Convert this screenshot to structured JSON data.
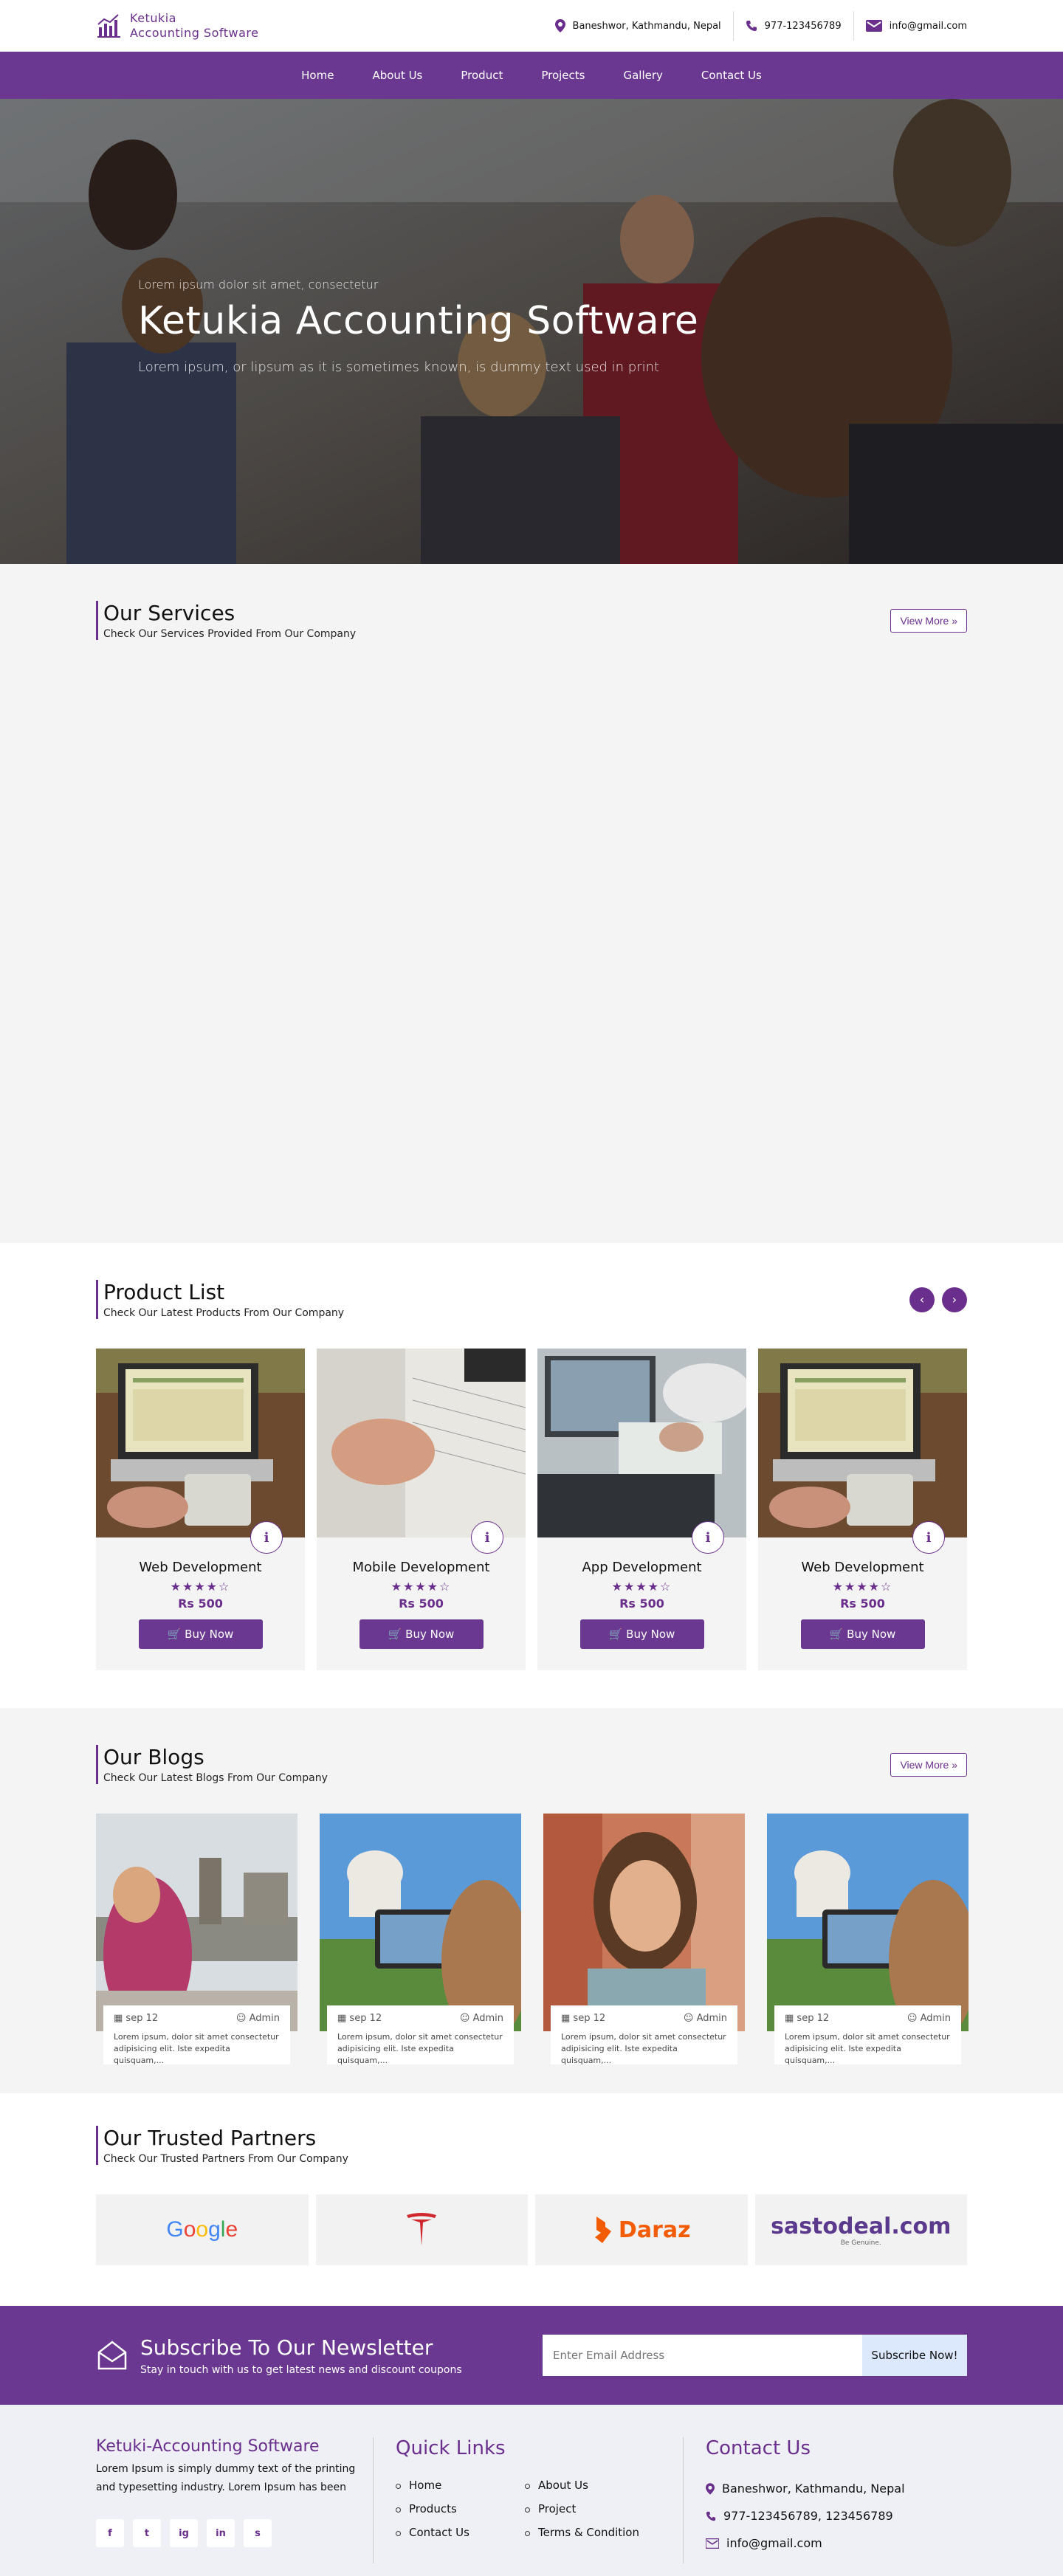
{
  "brand": {
    "name_line1": "Ketukia",
    "name_line2": "Accounting Software"
  },
  "topbar": {
    "address": "Baneshwor, Kathmandu, Nepal",
    "phone": "977-123456789",
    "email": "info@gmail.com"
  },
  "nav": {
    "items": [
      "Home",
      "About Us",
      "Product",
      "Projects",
      "Gallery",
      "Contact Us"
    ]
  },
  "hero": {
    "small": "Lorem ipsum dolor sit amet, consectetur",
    "title": "Ketukia Accounting Software",
    "subtitle": "Lorem ipsum, or lipsum as it is sometimes known, is dummy text used in print"
  },
  "services": {
    "title": "Our Services",
    "subtitle": "Check Our Services Provided From Our Company",
    "view_more": "View More »"
  },
  "products": {
    "title": "Product List",
    "subtitle": "Check Our Latest Products From Our Company",
    "items": [
      {
        "name": "Web Development",
        "stars": "★★★★☆",
        "price": "Rs 500",
        "buy": "Buy Now"
      },
      {
        "name": "Mobile Development",
        "stars": "★★★★☆",
        "price": "Rs 500",
        "buy": "Buy Now"
      },
      {
        "name": "App Development",
        "stars": "★★★★☆",
        "price": "Rs 500",
        "buy": "Buy Now"
      },
      {
        "name": "Web Development",
        "stars": "★★★★☆",
        "price": "Rs 500",
        "buy": "Buy Now"
      }
    ]
  },
  "blogs": {
    "title": "Our Blogs",
    "subtitle": "Check Our Latest Blogs From Our Company",
    "view_more": "View More »",
    "items": [
      {
        "date": "sep 12",
        "author": "Admin",
        "text": "Lorem ipsum, dolor sit amet consectetur adipisicing elit. Iste expedita quisquam,..."
      },
      {
        "date": "sep 12",
        "author": "Admin",
        "text": "Lorem ipsum, dolor sit amet consectetur adipisicing elit. Iste expedita quisquam,..."
      },
      {
        "date": "sep 12",
        "author": "Admin",
        "text": "Lorem ipsum, dolor sit amet consectetur adipisicing elit. Iste expedita quisquam,..."
      },
      {
        "date": "sep 12",
        "author": "Admin",
        "text": "Lorem ipsum, dolor sit amet consectetur adipisicing elit. Iste expedita quisquam,..."
      }
    ]
  },
  "partners": {
    "title": "Our Trusted Partners",
    "subtitle": "Check Our Trusted Partners From Our Company",
    "logos": [
      "Google",
      "Tesla",
      "Daraz",
      "sastodeal.com"
    ],
    "sasto_tagline": "Be Genuine."
  },
  "newsletter": {
    "title": "Subscribe To Our Newsletter",
    "subtitle": "Stay in touch with us to get latest news and discount coupons",
    "placeholder": "Enter Email Address",
    "button": "Subscribe Now!"
  },
  "footer": {
    "brand": "Ketuki-Accounting Software",
    "about": "Lorem Ipsum is simply dummy text of the printing and typesetting industry. Lorem Ipsum has been",
    "socials": [
      "f",
      "t",
      "ig",
      "in",
      "s"
    ],
    "quick_links_title": "Quick Links",
    "links": [
      "Home",
      "About Us",
      "Products",
      "Project",
      "Contact Us",
      "Terms & Condition"
    ],
    "contact_title": "Contact Us",
    "address": "Baneshwor, Kathmandu, Nepal",
    "phones": "977-123456789, 123456789",
    "email": "info@gmail.com"
  },
  "colors": {
    "primary": "#6a3890",
    "accent": "#6a2f8c",
    "light_bg": "#f4f4f4"
  }
}
